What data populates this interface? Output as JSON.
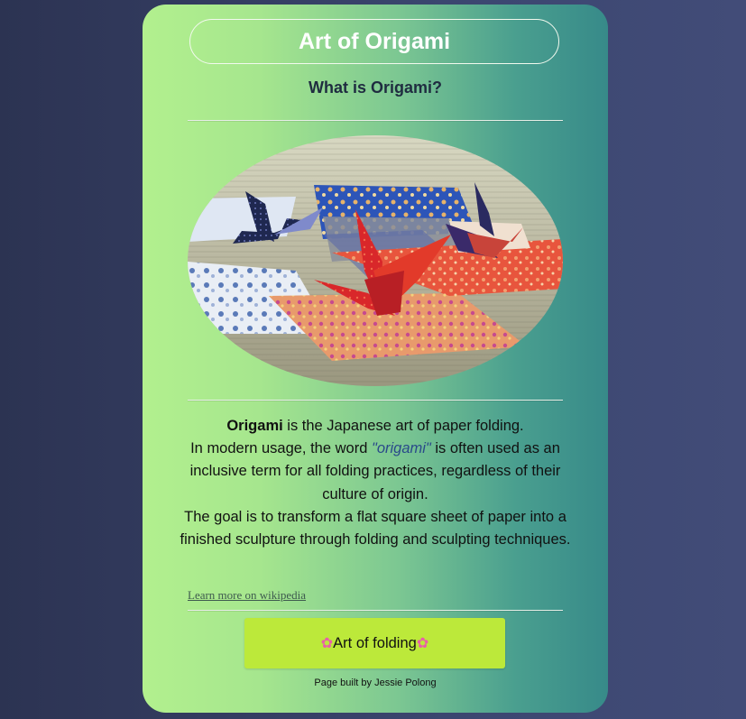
{
  "header": {
    "title": "Art of Origami",
    "subtitle": "What is Origami?"
  },
  "image": {
    "subject": "origami paper cranes on patterned paper"
  },
  "description": {
    "line1_bold": "Origami",
    "line1_rest": " is the Japanese art of paper folding.",
    "line2_pre": "In modern usage, the word ",
    "line2_em": "\"origami\"",
    "line2_post": " is often used as an inclusive term for all folding practices, regardless of their culture of origin.",
    "line3": "The goal is to transform a flat square sheet of paper into a finished sculpture through folding and sculpting techniques."
  },
  "link": {
    "label": "Learn more on wikipedia"
  },
  "button": {
    "label": "Art of folding",
    "flower_glyph": "✿",
    "flower_color": "#e860a8",
    "background": "#bce93a"
  },
  "footer": {
    "credit": "Page built by Jessie Polong"
  }
}
